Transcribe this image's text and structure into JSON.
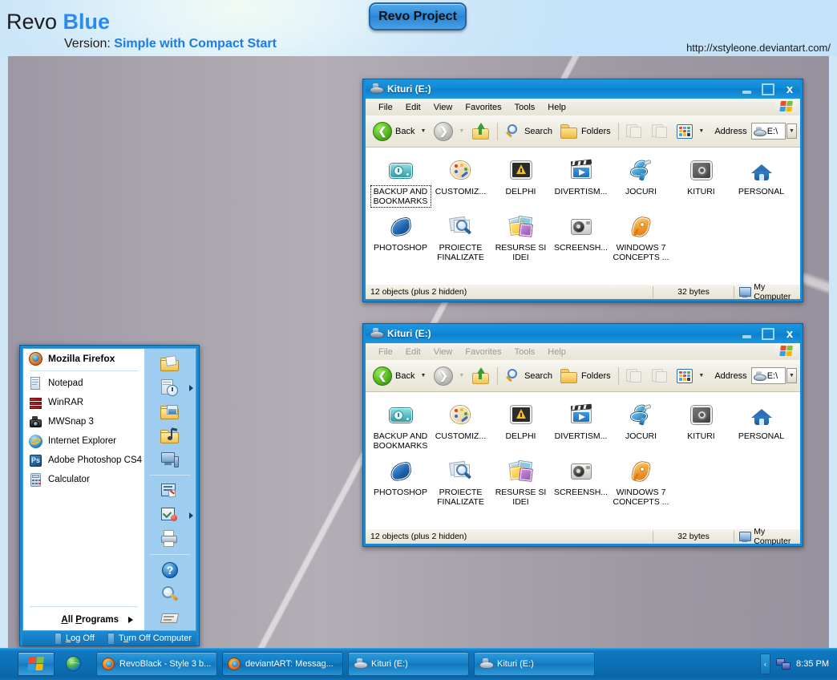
{
  "banner": {
    "title_plain": "Revo ",
    "title_accent": "Blue",
    "version_label": "Version: ",
    "version_value": "Simple with Compact Start",
    "url": "http://xstyleone.deviantart.com/",
    "project_badge": "Revo Project"
  },
  "colors": {
    "accent_blue": "#1a8ad4",
    "title_accent": "#2a8bef",
    "taskbar_blue": "#0c6fb4",
    "desktop_gray": "#a8a2ac"
  },
  "windows": [
    {
      "title": "Kituri (E:)",
      "active": true,
      "menu": [
        "File",
        "Edit",
        "View",
        "Favorites",
        "Tools",
        "Help"
      ],
      "toolbar": {
        "back": "Back",
        "search": "Search",
        "folders": "Folders",
        "address_label": "Address",
        "address_value": "E:\\"
      },
      "items": [
        {
          "label": "BACKUP AND BOOKMARKS",
          "icon": "backup-icon",
          "selected": true
        },
        {
          "label": "CUSTOMIZ...",
          "icon": "palette-icon",
          "selected": false
        },
        {
          "label": "DELPHI",
          "icon": "warning-icon",
          "selected": false
        },
        {
          "label": "DIVERTISM...",
          "icon": "clapperboard-icon",
          "selected": false
        },
        {
          "label": "JOCURI",
          "icon": "joystick-icon",
          "selected": false
        },
        {
          "label": "KITURI",
          "icon": "gear-icon",
          "selected": false
        },
        {
          "label": "PERSONAL",
          "icon": "home-icon",
          "selected": false
        },
        {
          "label": "PHOTOSHOP",
          "icon": "photoshop-feather-icon",
          "selected": false
        },
        {
          "label": "PROIECTE FINALIZATE",
          "icon": "magnifier-photos-icon",
          "selected": false
        },
        {
          "label": "RESURSE SI IDEI",
          "icon": "photos-stack-icon",
          "selected": false
        },
        {
          "label": "SCREENSH...",
          "icon": "camera-icon",
          "selected": false
        },
        {
          "label": "WINDOWS 7 CONCEPTS ...",
          "icon": "pen-nib-icon",
          "selected": false
        }
      ],
      "status": {
        "objects": "12 objects (plus 2 hidden)",
        "size": "32 bytes",
        "location": "My Computer"
      }
    },
    {
      "title": "Kituri (E:)",
      "active": false,
      "menu": [
        "File",
        "Edit",
        "View",
        "Favorites",
        "Tools",
        "Help"
      ],
      "toolbar": {
        "back": "Back",
        "search": "Search",
        "folders": "Folders",
        "address_label": "Address",
        "address_value": "E:\\"
      },
      "items": [
        {
          "label": "BACKUP AND BOOKMARKS",
          "icon": "backup-icon",
          "selected": false
        },
        {
          "label": "CUSTOMIZ...",
          "icon": "palette-icon",
          "selected": false
        },
        {
          "label": "DELPHI",
          "icon": "warning-icon",
          "selected": false
        },
        {
          "label": "DIVERTISM...",
          "icon": "clapperboard-icon",
          "selected": false
        },
        {
          "label": "JOCURI",
          "icon": "joystick-icon",
          "selected": false
        },
        {
          "label": "KITURI",
          "icon": "gear-icon",
          "selected": false
        },
        {
          "label": "PERSONAL",
          "icon": "home-icon",
          "selected": false
        },
        {
          "label": "PHOTOSHOP",
          "icon": "photoshop-feather-icon",
          "selected": false
        },
        {
          "label": "PROIECTE FINALIZATE",
          "icon": "magnifier-photos-icon",
          "selected": false
        },
        {
          "label": "RESURSE SI IDEI",
          "icon": "photos-stack-icon",
          "selected": false
        },
        {
          "label": "SCREENSH...",
          "icon": "camera-icon",
          "selected": false
        },
        {
          "label": "WINDOWS 7 CONCEPTS ...",
          "icon": "pen-nib-icon",
          "selected": false
        }
      ],
      "status": {
        "objects": "12 objects (plus 2 hidden)",
        "size": "32 bytes",
        "location": "My Computer"
      }
    }
  ],
  "start_menu": {
    "programs": [
      {
        "label": "Mozilla Firefox",
        "icon": "firefox-icon",
        "pinned": true
      },
      {
        "label": "Notepad",
        "icon": "notepad-icon",
        "pinned": false
      },
      {
        "label": "WinRAR",
        "icon": "winrar-icon",
        "pinned": false
      },
      {
        "label": "MWSnap 3",
        "icon": "mwsnap-camera-icon",
        "pinned": false
      },
      {
        "label": "Internet Explorer",
        "icon": "internet-explorer-icon",
        "pinned": false
      },
      {
        "label": "Adobe Photoshop CS4",
        "icon": "photoshop-ps-icon",
        "pinned": false
      },
      {
        "label": "Calculator",
        "icon": "calculator-icon",
        "pinned": false
      }
    ],
    "all_programs": "All Programs",
    "right_panel": [
      {
        "name": "my-documents-icon",
        "arrow": false
      },
      {
        "name": "recent-documents-icon",
        "arrow": true
      },
      {
        "name": "my-pictures-icon",
        "arrow": false
      },
      {
        "name": "my-music-icon",
        "arrow": false
      },
      {
        "name": "my-computer-icon",
        "arrow": false
      },
      {
        "divider": true
      },
      {
        "name": "control-panel-icon",
        "arrow": false
      },
      {
        "name": "set-program-access-icon",
        "arrow": true
      },
      {
        "name": "printers-and-faxes-icon",
        "arrow": false
      },
      {
        "divider": true
      },
      {
        "name": "help-and-support-icon",
        "arrow": false
      },
      {
        "name": "search-icon",
        "arrow": false
      },
      {
        "name": "run-icon",
        "arrow": false
      }
    ],
    "log_off": "Log Off",
    "turn_off": "Turn Off Computer"
  },
  "taskbar": {
    "start_label": "start",
    "tasks": [
      {
        "label": "RevoBlack - Style 3 b...",
        "icon": "firefox-icon",
        "active": false
      },
      {
        "label": "deviantART: Messag...",
        "icon": "firefox-icon",
        "active": true
      },
      {
        "label": "Kituri (E:)",
        "icon": "drive-icon",
        "active": false
      },
      {
        "label": "Kituri (E:)",
        "icon": "drive-icon",
        "active": false
      }
    ],
    "tray": {
      "expander": "‹",
      "network_icon": "network-icon",
      "clock": "8:35 PM"
    }
  }
}
